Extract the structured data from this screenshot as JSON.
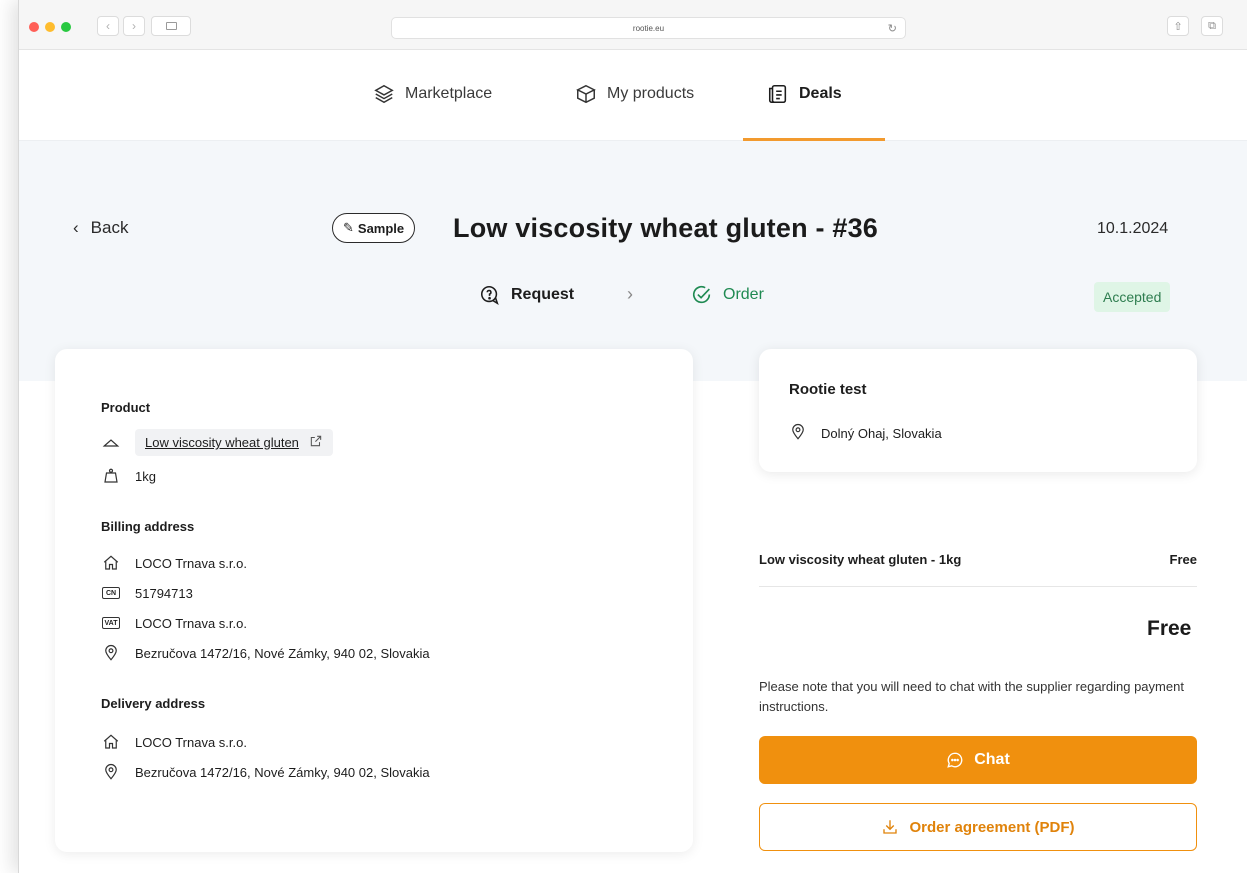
{
  "browser": {
    "url": "rootie.eu"
  },
  "nav": {
    "items": [
      {
        "label": "Marketplace",
        "icon": "layers-icon"
      },
      {
        "label": "My products",
        "icon": "box-icon"
      },
      {
        "label": "Deals",
        "icon": "deals-icon"
      }
    ],
    "active": "Deals",
    "accent": "#f29a2e"
  },
  "header": {
    "back_label": "Back",
    "tag_label": "Sample",
    "title": "Low viscosity wheat gluten - #36",
    "date": "10.1.2024",
    "steps": {
      "request": "Request",
      "order": "Order"
    },
    "status": "Accepted"
  },
  "details": {
    "product_title": "Product",
    "product_name": "Low viscosity wheat gluten",
    "quantity": "1kg",
    "billing_title": "Billing address",
    "billing": {
      "company": "LOCO Trnava s.r.o.",
      "cn_tag": "CN",
      "cn": "51794713",
      "vat_tag": "VAT",
      "vat": "LOCO Trnava s.r.o.",
      "address": "Bezručova 1472/16, Nové Zámky, 940 02, Slovakia"
    },
    "delivery_title": "Delivery address",
    "delivery": {
      "company": "LOCO Trnava s.r.o.",
      "address": "Bezručova 1472/16, Nové Zámky, 940 02, Slovakia"
    }
  },
  "supplier": {
    "name": "Rootie test",
    "location": "Dolný Ohaj, Slovakia"
  },
  "summary": {
    "item": "Low viscosity wheat gluten - 1kg",
    "item_price": "Free",
    "total": "Free",
    "note": "Please note that you will need to chat with the supplier regarding payment instructions.",
    "chat_label": "Chat",
    "pdf_label": "Order agreement (PDF)"
  }
}
